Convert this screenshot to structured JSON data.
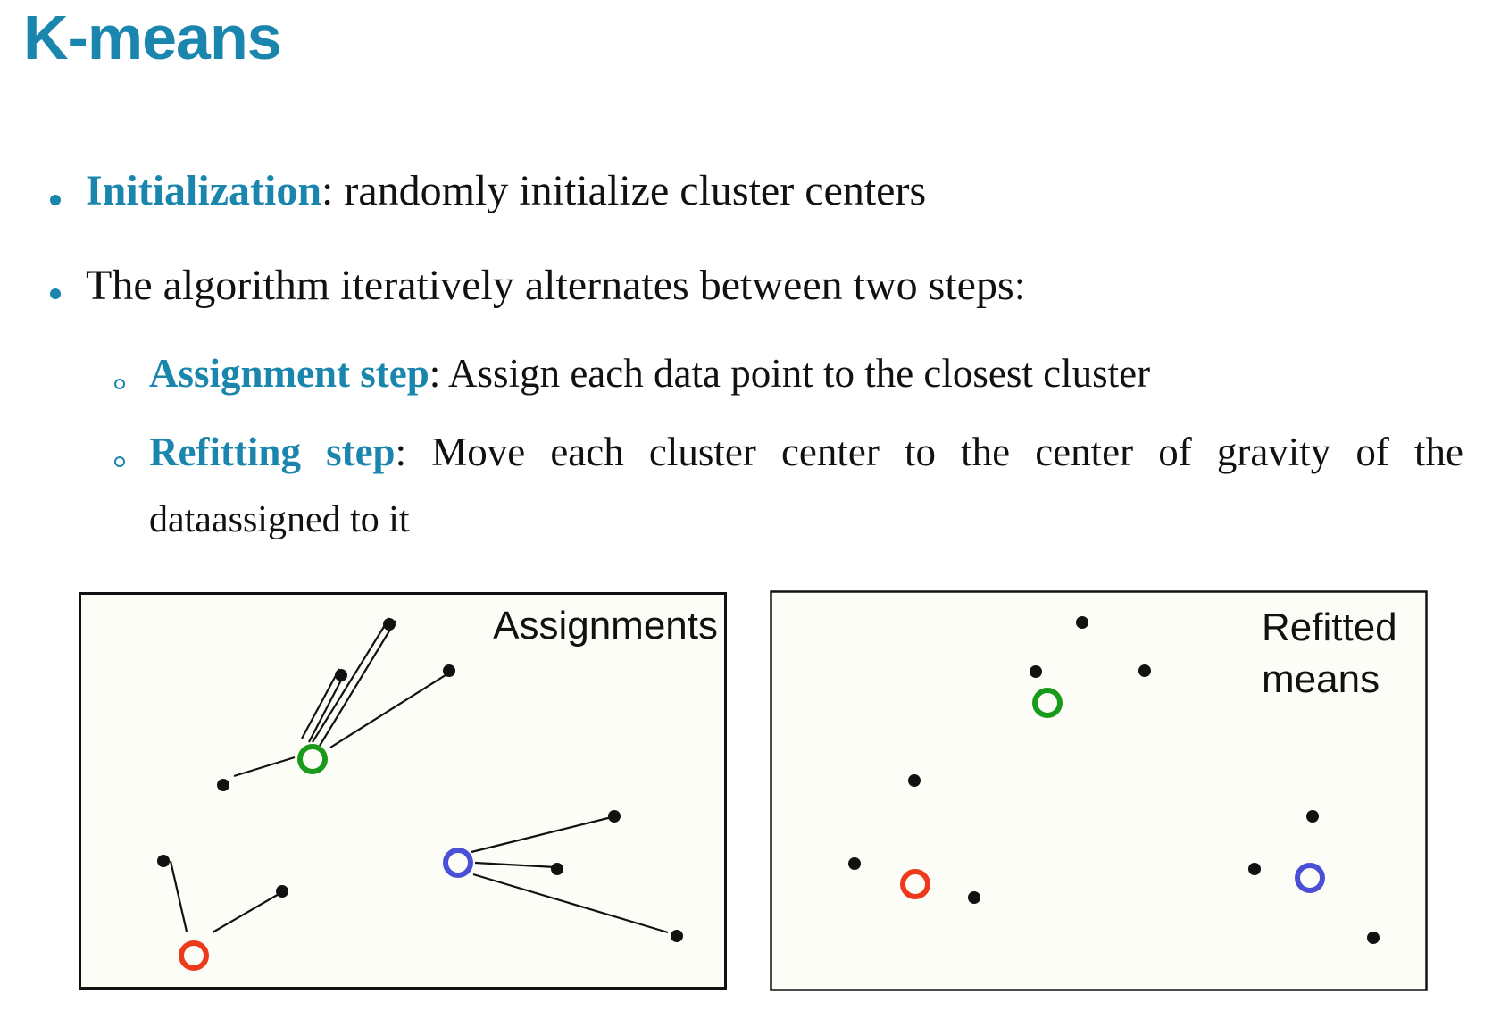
{
  "title": "K-means",
  "bullets": {
    "init_term": "Initialization",
    "init_text": ": randomly initialize cluster centers",
    "alg_text": "The algorithm iteratively alternates between two steps:"
  },
  "sub_bullets": {
    "assign_term": "Assignment step",
    "assign_text": ": Assign each data point to the closest cluster",
    "refit_term": "Refitting step",
    "refit_text": ": Move each cluster center to the center of gravity of the",
    "refit_text_cont": "dataassigned to it"
  },
  "colors": {
    "accent": "#1a86ad",
    "green": "#1a9a1a",
    "red": "#ee3a1c",
    "blue": "#4a4fd6",
    "panel_bg": "#fdfdf8"
  },
  "figures": {
    "assignments_label": "Assignments",
    "refitted_label_line1": "Refitted",
    "refitted_label_line2": "means"
  }
}
